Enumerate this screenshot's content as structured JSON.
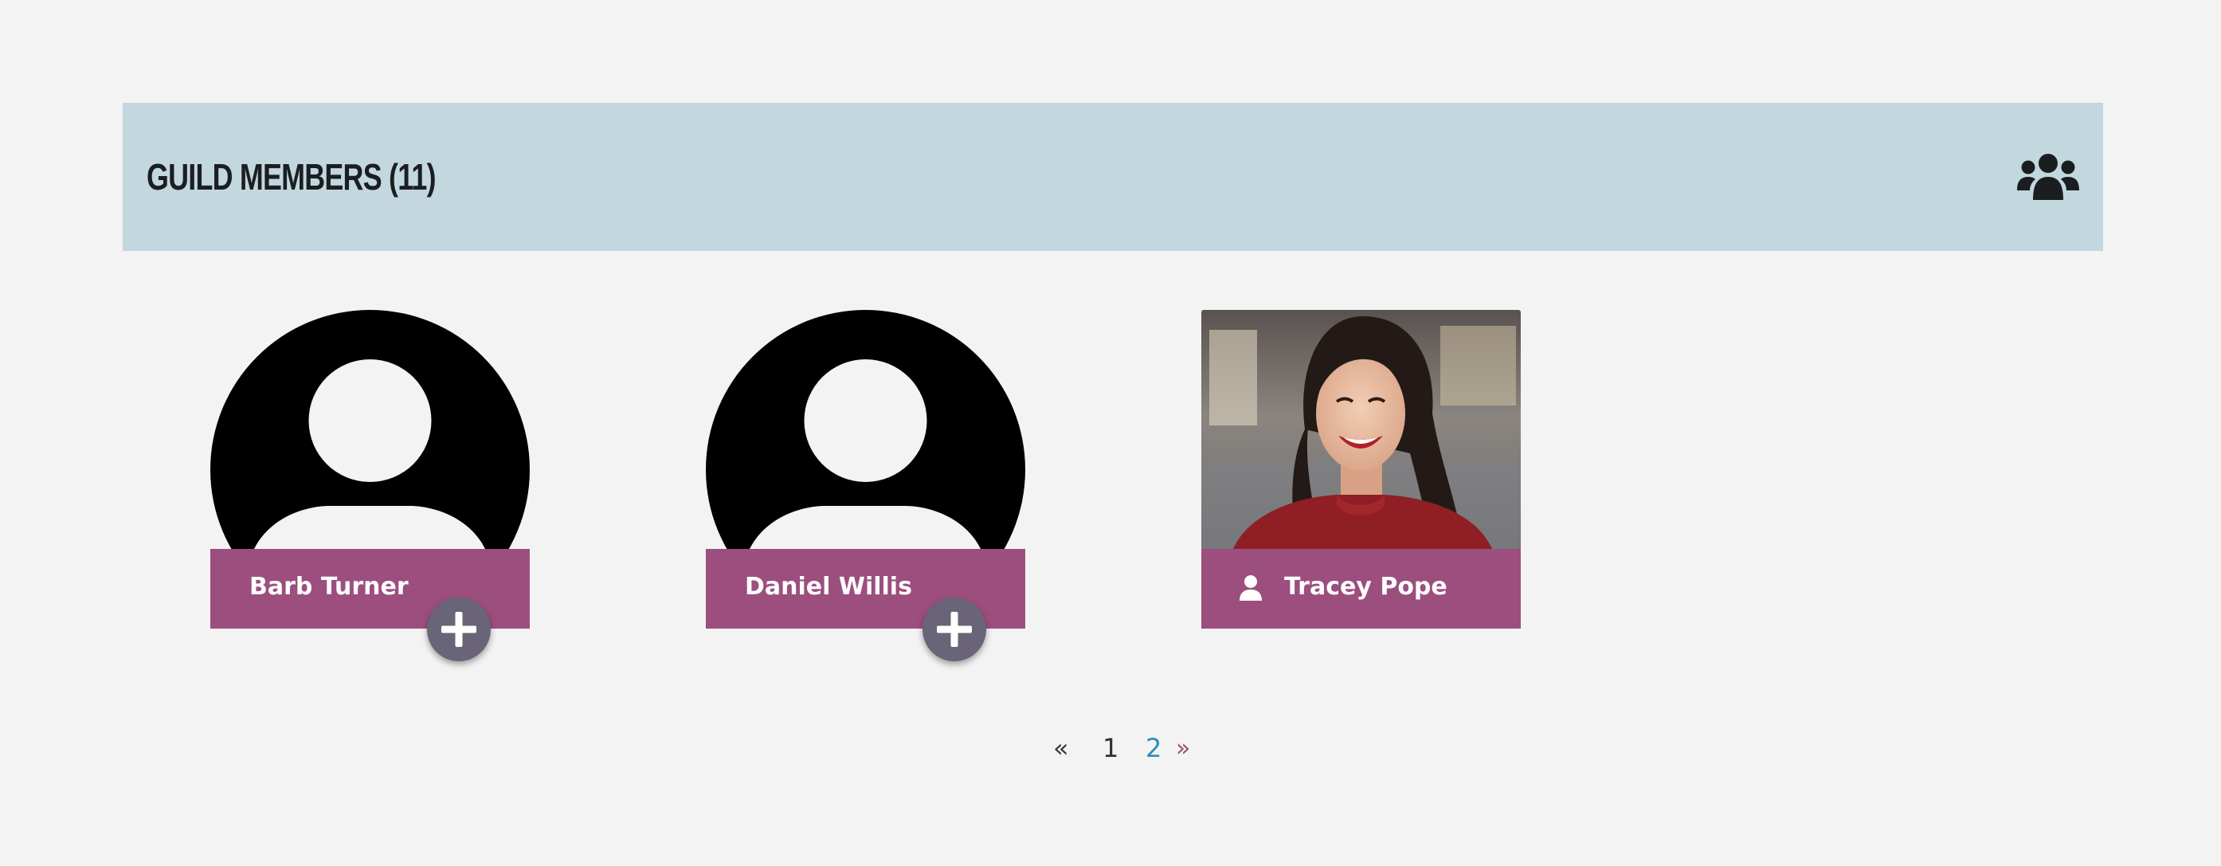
{
  "header": {
    "title": "GUILD MEMBERS (11)",
    "icon": "users-group-icon"
  },
  "members": [
    {
      "name": "Barb Turner",
      "avatar": "default-avatar",
      "action": "add-friend"
    },
    {
      "name": "Daniel Willis",
      "avatar": "default-avatar",
      "action": "add-friend"
    },
    {
      "name": "Tracey Pope",
      "avatar": "photo",
      "badge_icon": "user-icon"
    }
  ],
  "pagination": {
    "prev": "«",
    "pages": [
      "1",
      "2"
    ],
    "current": "2",
    "next": "»"
  },
  "colors": {
    "background": "#f3f3f3",
    "header_bg": "#c2d7de",
    "name_bar": "#9c4e7e",
    "add_button": "#6a6478",
    "active_page": "#2b8fb4"
  }
}
